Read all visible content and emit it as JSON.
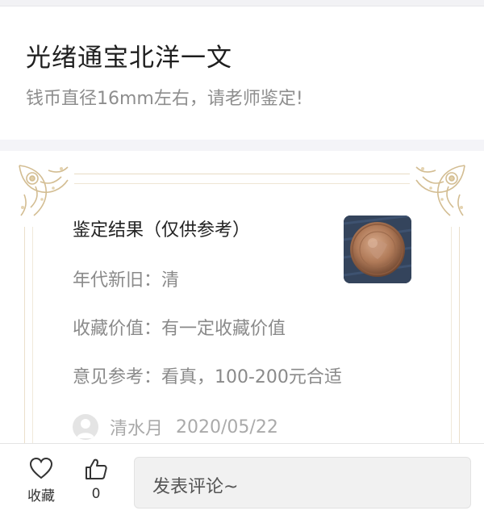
{
  "post": {
    "title": "光绪通宝北洋一文",
    "description": "钱币直径16mm左右，请老师鉴定!"
  },
  "appraisal": {
    "heading": "鉴定结果（仅供参考）",
    "rows": [
      "年代新旧：清",
      "收藏价值：有一定收藏价值",
      "意见参考：看真，100-200元合适"
    ],
    "appraiser_name": "清水月",
    "date": "2020/05/22",
    "accent_color": "#d9c6a0"
  },
  "bottom_bar": {
    "favorite_label": "收藏",
    "like_count": "0",
    "comment_placeholder": "发表评论~"
  },
  "icons": [
    "ornament-corner-icon",
    "coin-photo",
    "avatar-icon",
    "heart-icon",
    "thumbs-up-icon"
  ]
}
